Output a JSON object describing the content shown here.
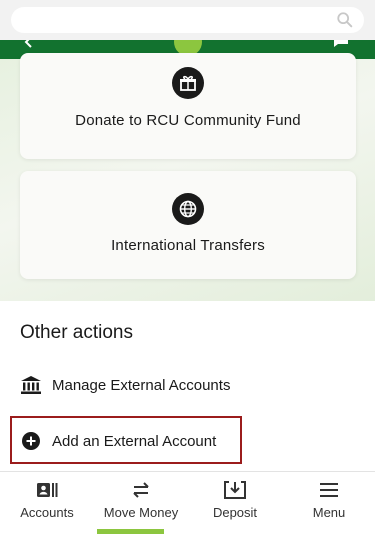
{
  "search": {
    "placeholder": ""
  },
  "cards": [
    {
      "label": "Donate to RCU Community Fund",
      "icon": "gift-icon"
    },
    {
      "label": "International Transfers",
      "icon": "globe-icon"
    }
  ],
  "other_actions": {
    "title": "Other actions",
    "items": [
      {
        "label": "Manage External Accounts",
        "icon": "bank-icon"
      },
      {
        "label": "Add an External Account",
        "icon": "plus-circle-icon"
      }
    ]
  },
  "bottom_nav": {
    "items": [
      {
        "label": "Accounts",
        "icon": "accounts-icon"
      },
      {
        "label": "Move Money",
        "icon": "transfer-arrows-icon",
        "active": true
      },
      {
        "label": "Deposit",
        "icon": "deposit-icon"
      },
      {
        "label": "Menu",
        "icon": "menu-icon"
      }
    ]
  },
  "colors": {
    "header_green": "#12722f",
    "accent_green": "#8cc63f",
    "highlight_red": "#9b1c1c"
  }
}
